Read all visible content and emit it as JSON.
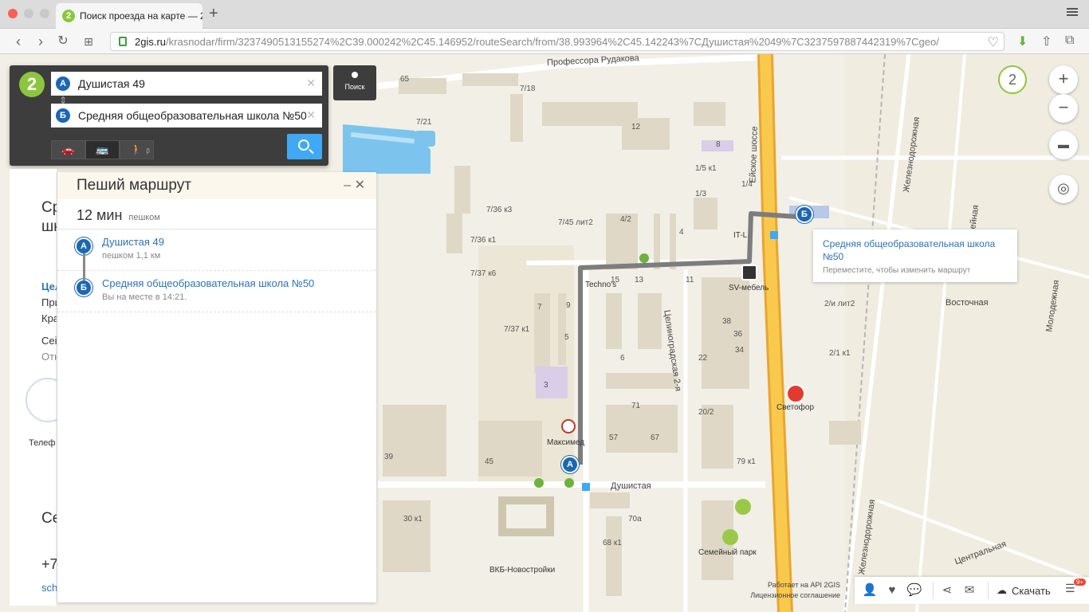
{
  "browser": {
    "tab_title": "Поиск проезда на карте — 2",
    "url_host": "2gis.ru",
    "url_path": "/krasnodar/firm/3237490513155274%2C39.000242%2C45.146952/routeSearch/from/38.993964%2C45.142243%7CДушистая%2049%7C3237597887442319%7Cgeo/"
  },
  "search": {
    "from_value": "Душистая 49",
    "to_value": "Средняя общеобразовательная школа №50",
    "from_marker": "А",
    "to_marker": "Б",
    "search_button_label": "Поиск",
    "modes": [
      {
        "name": "car",
        "icon": "car-icon",
        "glyph": "🚗"
      },
      {
        "name": "bus",
        "icon": "bus-icon",
        "glyph": "🚌",
        "active": true
      },
      {
        "name": "walk",
        "icon": "walk-icon",
        "glyph": "🚶",
        "beta": "β"
      }
    ]
  },
  "left_card": {
    "title_fragment": "Ср",
    "title_fragment2": "шк",
    "line1": "Цел",
    "line2": "При",
    "line3": "Кра",
    "line4": "Сеі",
    "line5": "Отк",
    "line6": "Телеф",
    "line7": "Сеі",
    "line8": "+7",
    "line9": "sch"
  },
  "route": {
    "title": "Пеший маршрут",
    "duration": "12 мин",
    "mode_text": "пешком",
    "stops": [
      {
        "marker": "А",
        "name": "Душистая 49",
        "sub": "пешком 1,1 км"
      },
      {
        "marker": "Б",
        "name": "Средняя общеобразовательная школа №50",
        "sub": "Вы на месте в 14:21."
      }
    ]
  },
  "balloon": {
    "title": "Средняя общеобразовательная школа №50",
    "hint": "Переместите, чтобы изменить маршрут"
  },
  "map": {
    "zoom_level": "2",
    "roads": {
      "rudakova": "Профессора Рудакова",
      "eyskoe": "Ейское шоссе",
      "dushistaya": "Душистая",
      "tselinogradskaya": "Целиноградская 2-я",
      "zheleznodorozhnaya": "Железнодорожная",
      "zheleznodorozhnaya2": "Железнодорожная",
      "lineynaya": "Линейная",
      "molodezhnaya": "Молодежная",
      "tsentralnaya": "Центральная",
      "vostochnaya": "Восточная"
    },
    "pois": {
      "technos": "Techno's",
      "sv_mebel": "SV-мебель",
      "svetofor": "Светофор",
      "maksimed": "Максимед",
      "semeyny_park": "Семейный парк",
      "vkb": "ВКБ-Новостройки",
      "it": "IT-L"
    },
    "buildings": [
      "65",
      "7/18",
      "7/21",
      "12",
      "8",
      "1/5 к1",
      "1/3",
      "1/4",
      "4/2",
      "4",
      "7/36 к3",
      "7/36 к1",
      "7/45 лит2",
      "7/37 к6",
      "7/37 к1",
      "9",
      "7",
      "5",
      "3",
      "15",
      "13",
      "11",
      "6",
      "38",
      "36",
      "34",
      "22",
      "20/2",
      "71",
      "57",
      "67",
      "45",
      "39",
      "30 к1",
      "68 к1",
      "70а",
      "79 к1",
      "2/и лит2",
      "2/1 к1"
    ]
  },
  "bottom": {
    "api_note": "Работает на API 2GIS",
    "license": "Лицензионное соглашение",
    "download_label": "Скачать",
    "notifications": "9+"
  },
  "colors": {
    "accent_green": "#8cc63f",
    "route_blue": "#1b67b5",
    "link_blue": "#2a73b8",
    "search_blue": "#3fa9f5",
    "highway": "#f5b53d"
  }
}
